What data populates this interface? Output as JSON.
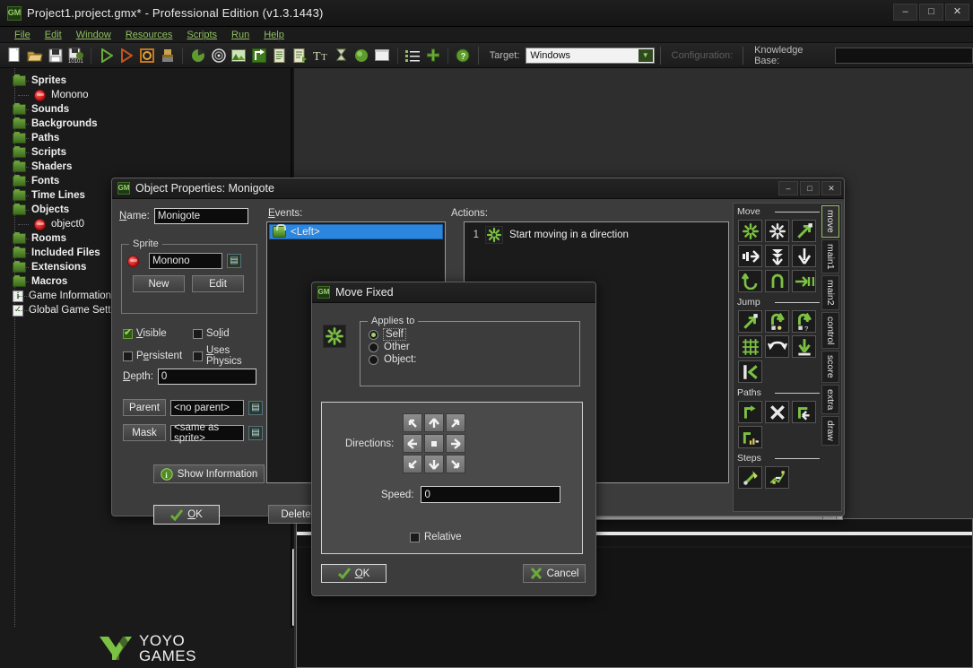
{
  "window": {
    "title": "Project1.project.gmx*  -  Professional Edition (v1.3.1443)",
    "icon": "gamemaker-icon",
    "minimize": "–",
    "maximize": "□",
    "close": "✕"
  },
  "menubar": {
    "items": [
      "File",
      "Edit",
      "Window",
      "Resources",
      "Scripts",
      "Run",
      "Help"
    ]
  },
  "toolbar": {
    "target_label": "Target:",
    "target_value": "Windows",
    "configuration_label": "Configuration:",
    "knowledge_base_label": "Knowledge Base:",
    "knowledge_base_value": "",
    "buttons": [
      "new-icon",
      "open-icon",
      "save-icon",
      "save-all-icon",
      "run-icon",
      "debug-icon",
      "stop-icon",
      "clean-icon",
      "create-sprite-icon",
      "create-sound-icon",
      "create-background-icon",
      "create-path-icon",
      "create-script-icon",
      "create-shader-icon",
      "create-font-icon",
      "create-timeline-icon",
      "create-object-icon",
      "create-room-icon",
      "global-game-settings-icon",
      "add-resource-icon",
      "help-icon"
    ]
  },
  "tree": {
    "items": [
      {
        "label": "Sprites",
        "icon": "folder-icon",
        "level": 1,
        "expander": "-",
        "bold": true
      },
      {
        "label": "Monono",
        "icon": "sprite-icon",
        "level": 2,
        "expander": "",
        "bold": false
      },
      {
        "label": "Sounds",
        "icon": "folder-icon",
        "level": 1,
        "expander": "",
        "bold": true
      },
      {
        "label": "Backgrounds",
        "icon": "folder-icon",
        "level": 1,
        "expander": "",
        "bold": true
      },
      {
        "label": "Paths",
        "icon": "folder-icon",
        "level": 1,
        "expander": "",
        "bold": true
      },
      {
        "label": "Scripts",
        "icon": "folder-icon",
        "level": 1,
        "expander": "",
        "bold": true
      },
      {
        "label": "Shaders",
        "icon": "folder-icon",
        "level": 1,
        "expander": "",
        "bold": true
      },
      {
        "label": "Fonts",
        "icon": "folder-icon",
        "level": 1,
        "expander": "",
        "bold": true
      },
      {
        "label": "Time Lines",
        "icon": "folder-icon",
        "level": 1,
        "expander": "",
        "bold": true
      },
      {
        "label": "Objects",
        "icon": "folder-icon",
        "level": 1,
        "expander": "-",
        "bold": true
      },
      {
        "label": "object0",
        "icon": "object-icon",
        "level": 2,
        "expander": "",
        "bold": false
      },
      {
        "label": "Rooms",
        "icon": "folder-icon",
        "level": 1,
        "expander": "",
        "bold": true
      },
      {
        "label": "Included Files",
        "icon": "folder-icon",
        "level": 1,
        "expander": "",
        "bold": true
      },
      {
        "label": "Extensions",
        "icon": "folder-icon",
        "level": 1,
        "expander": "",
        "bold": true
      },
      {
        "label": "Macros",
        "icon": "folder-icon",
        "level": 1,
        "expander": "+",
        "bold": true
      },
      {
        "label": "Game Information",
        "icon": "info-icon",
        "level": 1,
        "expander": "",
        "bold": false
      },
      {
        "label": "Global Game Settings",
        "icon": "settings-icon",
        "level": 1,
        "expander": "",
        "bold": false
      }
    ]
  },
  "object_properties": {
    "title": "Object Properties: Monigote",
    "icon": "gamemaker-icon",
    "minimize": "–",
    "maximize": "□",
    "close": "✕",
    "name_label": "Name:",
    "name_value": "Monigote",
    "sprite_group": "Sprite",
    "sprite_value": "Monono",
    "sprite_new": "New",
    "sprite_edit": "Edit",
    "visible_label": "Visible",
    "visible_checked": true,
    "solid_label": "Solid",
    "solid_checked": false,
    "persistent_label": "Persistent",
    "persistent_checked": false,
    "uses_physics_label": "Uses Physics",
    "uses_physics_checked": false,
    "depth_label": "Depth:",
    "depth_value": "0",
    "parent_button": "Parent",
    "parent_value": "<no parent>",
    "mask_button": "Mask",
    "mask_value": "<same as sprite>",
    "show_information": "Show Information",
    "ok_button": "OK",
    "events_label": "Events:",
    "events": [
      {
        "label": "<Left>",
        "selected": true,
        "icon": "mouse-event-icon"
      }
    ],
    "events_delete_button": "Delete",
    "actions_label": "Actions:",
    "actions": [
      {
        "num": "1",
        "label": "Start moving in a direction",
        "icon": "move-fixed-icon"
      }
    ]
  },
  "action_palette": {
    "tabs": [
      {
        "label": "move",
        "active": true
      },
      {
        "label": "main1",
        "active": false
      },
      {
        "label": "main2",
        "active": false
      },
      {
        "label": "control",
        "active": false
      },
      {
        "label": "score",
        "active": false
      },
      {
        "label": "extra",
        "active": false
      },
      {
        "label": "draw",
        "active": false
      }
    ],
    "sections": [
      {
        "title": "Move",
        "buttons": [
          "move-fixed-icon",
          "move-free-icon",
          "move-towards-icon",
          "speed-horizontal-icon",
          "speed-vertical-icon",
          "set-gravity-icon",
          "reverse-horizontal-icon",
          "reverse-vertical-icon",
          "set-friction-icon"
        ]
      },
      {
        "title": "Jump",
        "buttons": [
          "jump-to-position-icon",
          "jump-to-start-icon",
          "jump-to-random-icon",
          "align-to-grid-icon",
          "wrap-screen-icon",
          "move-to-contact-icon",
          "bounce-icon"
        ]
      },
      {
        "title": "Paths",
        "buttons": [
          "set-path-icon",
          "end-path-icon",
          "path-position-icon",
          "path-speed-icon"
        ]
      },
      {
        "title": "Steps",
        "buttons": [
          "step-towards-icon",
          "step-avoiding-icon"
        ]
      }
    ]
  },
  "move_fixed": {
    "title": "Move Fixed",
    "icon": "gamemaker-icon",
    "action_icon": "move-fixed-icon",
    "applies_to_label": "Applies to",
    "applies_to_options": [
      {
        "label": "Self",
        "selected": true
      },
      {
        "label": "Other",
        "selected": false
      },
      {
        "label": "Object:",
        "selected": false
      }
    ],
    "directions_label": "Directions:",
    "directions": [
      "arrow-up-left-icon",
      "arrow-up-icon",
      "arrow-up-right-icon",
      "arrow-left-icon",
      "stop-square-icon",
      "arrow-right-icon",
      "arrow-down-left-icon",
      "arrow-down-icon",
      "arrow-down-right-icon"
    ],
    "speed_label": "Speed:",
    "speed_value": "0",
    "relative_label": "Relative",
    "relative_checked": false,
    "ok_button": "OK",
    "cancel_button": "Cancel"
  },
  "footer": {
    "brand_line1": "YOYO",
    "brand_line2": "GAMES"
  },
  "colors": {
    "accent_green": "#8fbf5f",
    "selection_blue": "#2c86dd",
    "window_bg": "#3c3c3c",
    "panel_bg": "#1b1b1b",
    "sprite_red": "#c11010"
  }
}
